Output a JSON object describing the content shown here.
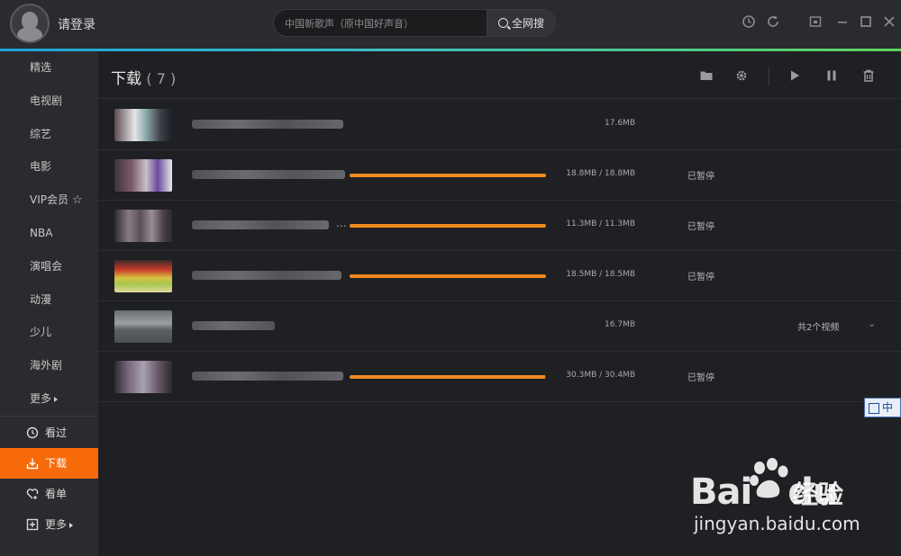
{
  "topbar": {
    "login_label": "请登录",
    "search_placeholder": "中国新歌声（原中国好声音）",
    "search_button": "全网搜"
  },
  "sidebar": {
    "items": [
      {
        "label": "精选"
      },
      {
        "label": "电视剧"
      },
      {
        "label": "综艺"
      },
      {
        "label": "电影"
      },
      {
        "label": "VIP会员"
      },
      {
        "label": "NBA"
      },
      {
        "label": "演唱会"
      },
      {
        "label": "动漫"
      },
      {
        "label": "少儿"
      },
      {
        "label": "海外剧"
      },
      {
        "label": "更多"
      }
    ],
    "bottom": [
      {
        "label": "看过",
        "icon": "history-icon"
      },
      {
        "label": "下载",
        "icon": "download-icon",
        "active": true
      },
      {
        "label": "看单",
        "icon": "heart-plus-icon"
      },
      {
        "label": "更多",
        "icon": "plus-box-icon"
      }
    ]
  },
  "main": {
    "title": "下载",
    "count": "( 7 )",
    "downloads": [
      {
        "size": "17.6MB",
        "status": "",
        "extra": "",
        "progress": null
      },
      {
        "size": "18.8MB / 18.8MB",
        "status": "已暂停",
        "extra": "",
        "progress": 1.0
      },
      {
        "size": "11.3MB / 11.3MB",
        "status": "已暂停",
        "extra": "",
        "progress": 1.0,
        "ellipsis": "..."
      },
      {
        "size": "18.5MB / 18.5MB",
        "status": "已暂停",
        "extra": "",
        "progress": 1.0
      },
      {
        "size": "16.7MB",
        "status": "",
        "extra": "共2个视频",
        "progress": null
      },
      {
        "size": "30.3MB / 30.4MB",
        "status": "已暂停",
        "extra": "",
        "progress": 0.997
      }
    ]
  },
  "watermark": {
    "brand": "Bai",
    "brand2": "du",
    "jingyan": "经验",
    "url": "jingyan.baidu.com"
  },
  "ime": {
    "label": "中"
  },
  "colors": {
    "accent": "#f76a0a",
    "progress": "#f08a1e",
    "topline_start": "#1fa3d9",
    "topline_end": "#5fd25a"
  }
}
